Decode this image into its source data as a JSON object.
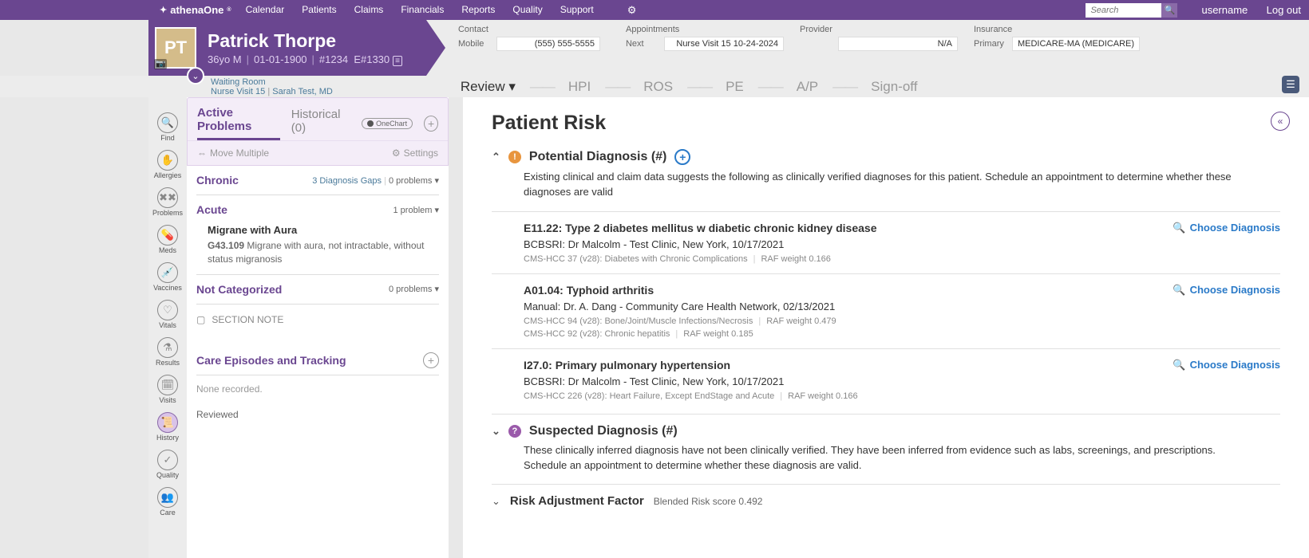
{
  "topbar": {
    "logo": "athenaOne",
    "nav": [
      "Calendar",
      "Patients",
      "Claims",
      "Financials",
      "Reports",
      "Quality",
      "Support"
    ],
    "search_placeholder": "Search",
    "username": "username",
    "logout": "Log out"
  },
  "patient": {
    "initials": "PT",
    "name": "Patrick Thorpe",
    "age_sex": "36yo M",
    "dob": "01-01-1900",
    "mrn": "#1234",
    "enc": "E#1330",
    "contact_label": "Contact",
    "mobile_label": "Mobile",
    "mobile_val": "(555) 555-5555",
    "appt_label": "Appointments",
    "next_label": "Next",
    "next_val": "Nurse Visit 15 10-24-2024",
    "provider_label": "Provider",
    "provider_val": "N/A",
    "insurance_label": "Insurance",
    "primary_label": "Primary",
    "primary_val": "MEDICARE-MA (MEDICARE)"
  },
  "context": {
    "line1": "Waiting Room",
    "line2a": "Nurse Visit 15",
    "line2b": "Sarah Test, MD",
    "tabs": {
      "review": "Review ▾",
      "hpi": "HPI",
      "ros": "ROS",
      "pe": "PE",
      "ap": "A/P",
      "signoff": "Sign-off"
    }
  },
  "rail": [
    {
      "icon": "🔍",
      "label": "Find"
    },
    {
      "icon": "✋",
      "label": "Allergies"
    },
    {
      "icon": "✖✖",
      "label": "Problems"
    },
    {
      "icon": "💊",
      "label": "Meds"
    },
    {
      "icon": "💉",
      "label": "Vaccines"
    },
    {
      "icon": "♡",
      "label": "Vitals"
    },
    {
      "icon": "⚗",
      "label": "Results"
    },
    {
      "icon": "🗓",
      "label": "Visits"
    },
    {
      "icon": "📜",
      "label": "History"
    },
    {
      "icon": "✓",
      "label": "Quality"
    },
    {
      "icon": "👥",
      "label": "Care"
    }
  ],
  "problems": {
    "tab_active": "Active Problems",
    "tab_hist": "Historical (0)",
    "onechart": "OneChart",
    "move": "Move Multiple",
    "settings": "Settings",
    "chronic": {
      "title": "Chronic",
      "gaps": "3  Diagnosis Gaps",
      "count": "0 problems ▾"
    },
    "acute": {
      "title": "Acute",
      "count": "1 problem ▾",
      "item": {
        "name": "Migrane with Aura",
        "code": "G43.109",
        "desc": "Migrane with aura, not intractable, without status migranosis"
      }
    },
    "notcat": {
      "title": "Not Categorized",
      "count": "0 problems ▾"
    },
    "section_note": "SECTION NOTE",
    "care_title": "Care Episodes and Tracking",
    "none": "None recorded.",
    "reviewed": "Reviewed"
  },
  "risk": {
    "title": "Patient Risk",
    "potential": {
      "title": "Potential Diagnosis (#)",
      "desc": "Existing clinical and claim data suggests the following as clinically verified diagnoses for this patient. Schedule an appointment to determine whether these diagnoses are valid"
    },
    "choose": "Choose Diagnosis",
    "dx": [
      {
        "title": "E11.22: Type 2 diabetes mellitus w diabetic chronic kidney disease",
        "source": "BCBSRI: Dr Malcolm - Test Clinic, New York, 10/17/2021",
        "meta": "CMS-HCC 37 (v28): Diabetes with Chronic Complications",
        "raf": "RAF weight 0.166"
      },
      {
        "title": "A01.04: Typhoid arthritis",
        "source": "Manual: Dr. A. Dang - Community Care Health Network, 02/13/2021",
        "meta": "CMS-HCC 94 (v28): Bone/Joint/Muscle Infections/Necrosis",
        "raf": "RAF weight 0.479",
        "meta2": "CMS-HCC 92 (v28): Chronic hepatitis",
        "raf2": "RAF weight 0.185"
      },
      {
        "title": "I27.0: Primary pulmonary hypertension",
        "source": "BCBSRI: Dr Malcolm - Test Clinic, New York, 10/17/2021",
        "meta": "CMS-HCC 226 (v28): Heart Failure, Except EndStage and Acute",
        "raf": "RAF weight 0.166"
      }
    ],
    "suspected": {
      "title": "Suspected Diagnosis (#)",
      "desc": "These clinically inferred diagnosis have not been clinically verified.  They have been inferred from evidence such as labs, screenings, and prescriptions.\nSchedule an appointment to determine whether these diagnosis are valid."
    },
    "raf": {
      "title": "Risk Adjustment Factor",
      "score": "Blended Risk score  0.492"
    }
  }
}
